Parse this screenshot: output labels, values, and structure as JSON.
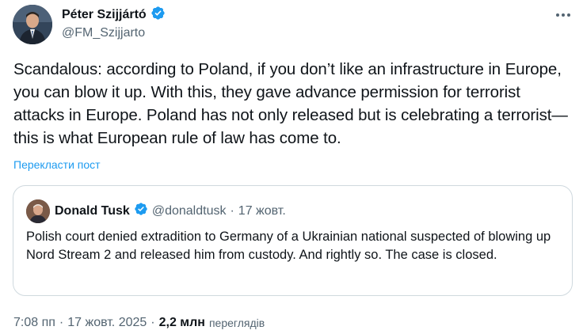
{
  "author": {
    "name": "Péter Szijjártó",
    "handle": "@FM_Szijjarto"
  },
  "tweet": {
    "text": "Scandalous: according to Poland, if you don’t like an infrastructure in Europe, you can blow it up. With this, they gave advance permission for terrorist attacks in Europe. Poland has not only released but is celebrating a terrorist—this is what European rule of law has come to.",
    "translate_label": "Перекласти пост"
  },
  "quote": {
    "name": "Donald Tusk",
    "handle": "@donaldtusk",
    "separator": "·",
    "time": "17 жовт.",
    "text": "Polish court denied extradition to Germany of a Ukrainian national suspected of blowing up Nord Stream 2 and released him from custody. And rightly so. The case is closed."
  },
  "meta": {
    "time": "7:08 пп",
    "sep1": "·",
    "date": "17 жовт. 2025",
    "sep2": "·",
    "views_count": "2,2 млн",
    "views_label": "переглядів"
  },
  "colors": {
    "verified": "#1d9bf0",
    "link": "#1d9bf0",
    "secondary_text": "#536471",
    "border": "#cfd9de"
  },
  "icons": [
    "verified-badge-icon",
    "more-options-icon"
  ]
}
